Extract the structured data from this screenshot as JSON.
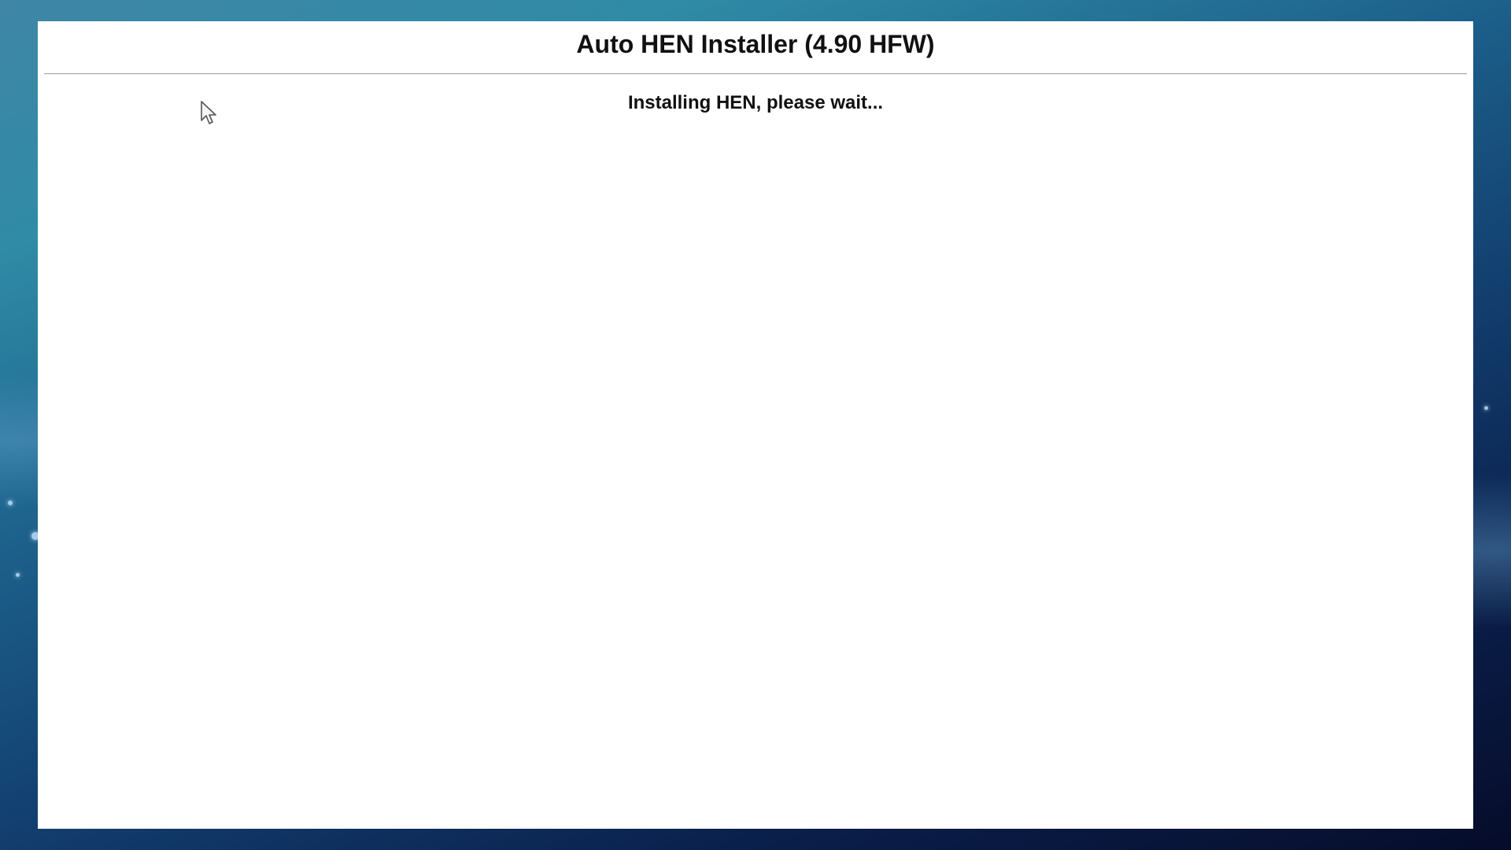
{
  "page": {
    "title": "Auto HEN Installer (4.90 HFW)",
    "status": "Installing HEN, please wait..."
  },
  "icons": {
    "cursor": "mouse-pointer-arrow-icon"
  },
  "colors": {
    "page_background": "#ffffff",
    "text": "#111111",
    "rule": "#a9a9a9",
    "desktop_top": "#3f86a6",
    "desktop_bottom": "#060c2a"
  }
}
